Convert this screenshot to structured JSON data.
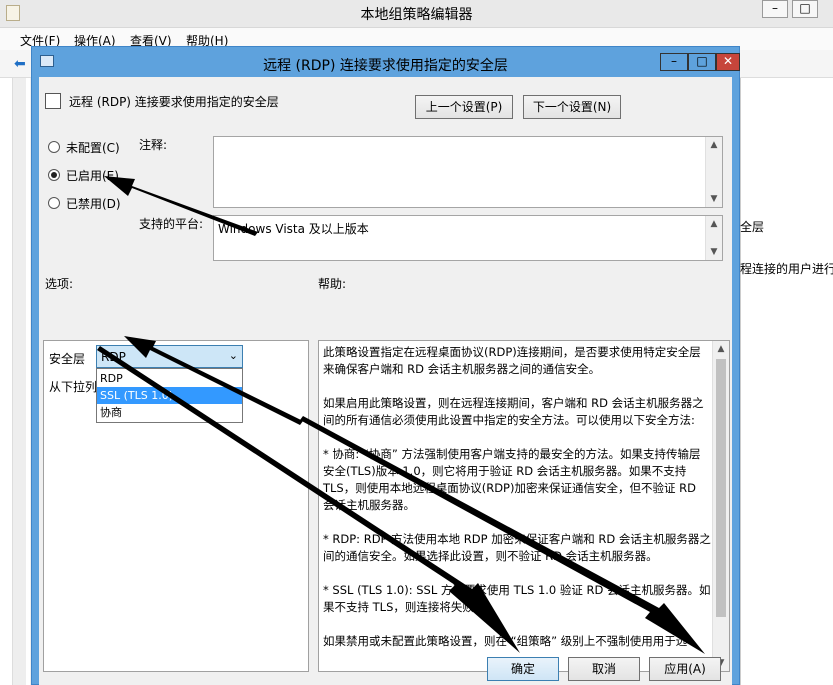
{
  "main_window": {
    "title": "本地组策略编辑器",
    "menu": [
      "文件(F)",
      "操作(A)",
      "查看(V)",
      "帮助(H)"
    ],
    "right_text_1": "全层",
    "right_text_2": "程连接的用户进行"
  },
  "dialog": {
    "title": "远程 (RDP) 连接要求使用指定的安全层",
    "header_title": "远程 (RDP) 连接要求使用指定的安全层",
    "prev_button": "上一个设置(P)",
    "next_button": "下一个设置(N)",
    "radio_not_configured": "未配置(C)",
    "radio_enabled": "已启用(E)",
    "radio_disabled": "已禁用(D)",
    "comment_label": "注释:",
    "supported_label": "支持的平台:",
    "supported_value": "Windows Vista 及以上版本",
    "options_label": "选项:",
    "help_label": "帮助:",
    "security_layer_label": "安全层",
    "partial_text": "从下拉列",
    "combo_value": "RDP",
    "combo_options": [
      "RDP",
      "SSL (TLS 1.0)",
      "协商"
    ],
    "help_paragraphs": [
      "此策略设置指定在远程桌面协议(RDP)连接期间，是否要求使用特定安全层来确保客户端和 RD 会话主机服务器之间的通信安全。",
      "如果启用此策略设置，则在远程连接期间，客户端和 RD 会话主机服务器之间的所有通信必须使用此设置中指定的安全方法。可以使用以下安全方法:",
      "* 协商: “协商” 方法强制使用客户端支持的最安全的方法。如果支持传输层安全(TLS)版本 1.0，则它将用于验证 RD 会话主机服务器。如果不支持 TLS，则使用本地远程桌面协议(RDP)加密来保证通信安全，但不验证 RD 会话主机服务器。",
      "* RDP: RDP 方法使用本地 RDP 加密来保证客户端和 RD 会话主机服务器之间的通信安全。如果选择此设置，则不验证 RD 会话主机服务器。",
      "* SSL (TLS 1.0): SSL 方法要求使用 TLS 1.0 验证 RD 会话主机服务器。如果不支持 TLS，则连接将失败。",
      "如果禁用或未配置此策略设置，则在 “组策略” 级别上不强制使用用于远"
    ],
    "ok_button": "确定",
    "cancel_button": "取消",
    "apply_button": "应用(A)"
  },
  "colors": {
    "dialog_frame": "#5ea2dd",
    "close_button": "#c7453b",
    "selection": "#3399ff",
    "annotation_arrow": "#000000"
  }
}
